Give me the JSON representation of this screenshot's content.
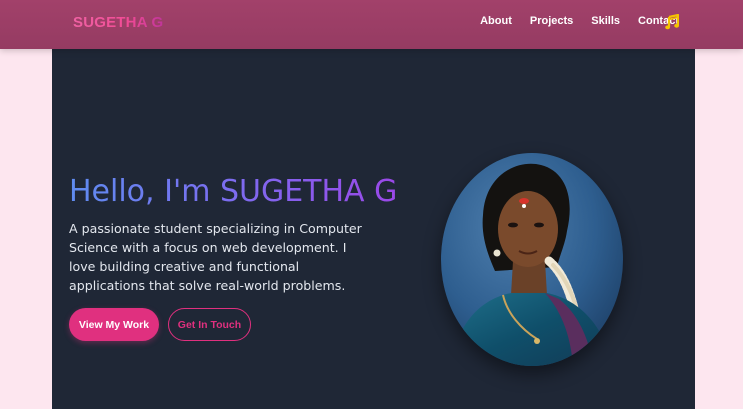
{
  "nav": {
    "logo": "SUGETHA G",
    "links": [
      "About",
      "Projects",
      "Skills",
      "Contact"
    ],
    "music_icon": "music-note-icon"
  },
  "hero": {
    "title": "Hello, I'm SUGETHA G",
    "description": "A passionate student specializing in Computer Science with a focus on web development. I love building creative and functional applications that solve real-world problems.",
    "primary_button": "View My Work",
    "secondary_button": "Get In Touch",
    "profile_image": "profile-photo"
  },
  "colors": {
    "nav_bg": "#a2416a",
    "hero_bg": "#1f2736",
    "accent_pink": "#e0307f",
    "title_gradient_start": "#5f8cf0",
    "title_gradient_end": "#9a48e8",
    "page_bg": "#fde6ef",
    "music_icon": "#f5c400"
  }
}
